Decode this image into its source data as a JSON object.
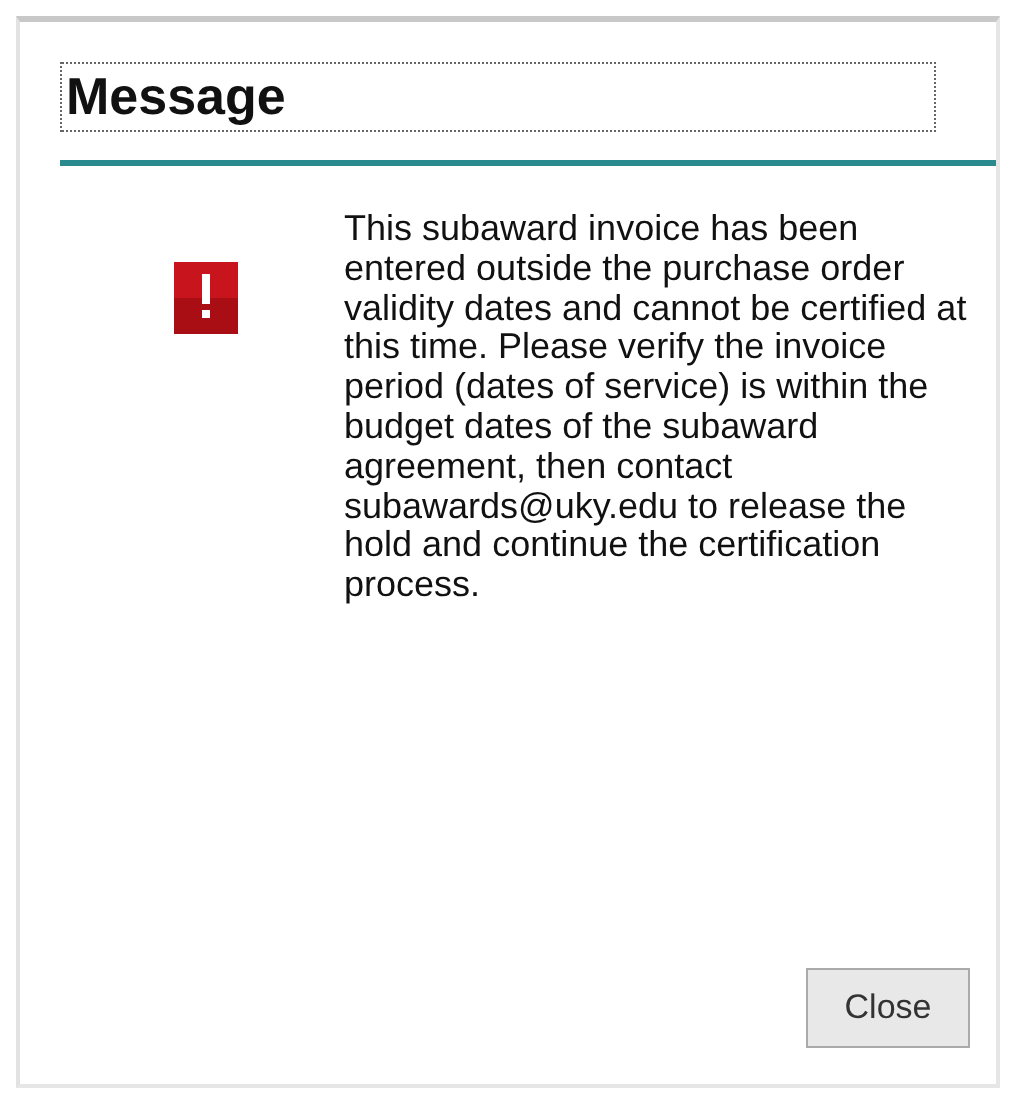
{
  "dialog": {
    "title": "Message",
    "message": "This subaward invoice has been entered outside the purchase order validity dates and cannot be certified at this time. Please verify the invoice period (dates of service) is within the budget dates of the subaward agreement, then contact subawards@uky.edu to release the hold and continue the certification process.",
    "kind": "error",
    "buttons": [
      "Close"
    ]
  }
}
